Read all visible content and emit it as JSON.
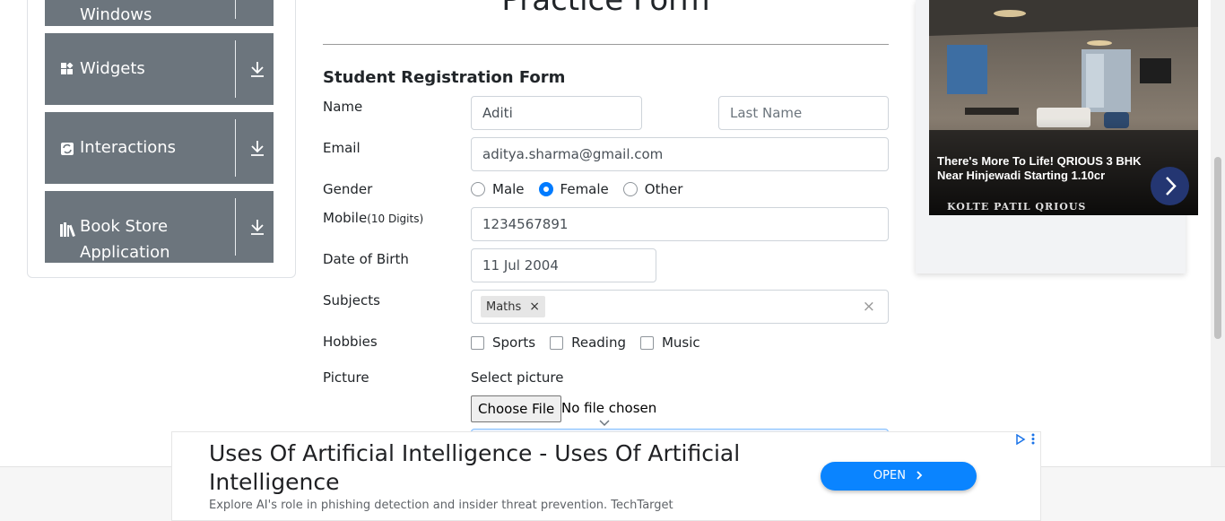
{
  "sidebar": {
    "groups": [
      {
        "label": "Windows",
        "icon": "window-icon"
      },
      {
        "label": "Widgets",
        "icon": "widgets-icon"
      },
      {
        "label": "Interactions",
        "icon": "interactions-icon"
      },
      {
        "label": "Book Store Application",
        "label_line1": "Book Store",
        "label_line2": "Application",
        "icon": "books-icon"
      }
    ]
  },
  "page": {
    "title": "Practice Form",
    "form_heading": "Student Registration Form"
  },
  "form": {
    "name_label": "Name",
    "first_name_value": "Aditi",
    "last_name_placeholder": "Last Name",
    "email_label": "Email",
    "email_value": "aditya.sharma@gmail.com",
    "gender_label": "Gender",
    "gender_options": [
      "Male",
      "Female",
      "Other"
    ],
    "gender_selected": "Female",
    "mobile_label": "Mobile",
    "mobile_hint": "(10 Digits)",
    "mobile_value": "1234567891",
    "dob_label": "Date of Birth",
    "dob_value": "11 Jul 2004",
    "subjects_label": "Subjects",
    "subjects": [
      "Maths"
    ],
    "subject_remove_glyph": "×",
    "subjects_clear_glyph": "×",
    "hobbies_label": "Hobbies",
    "hobbies": [
      "Sports",
      "Reading",
      "Music"
    ],
    "picture_label": "Picture",
    "picture_prompt": "Select picture",
    "choose_file_label": "Choose File",
    "file_status": "No file chosen"
  },
  "ad_right": {
    "headline": "There's More To Life! QRIOUS 3 BHK Near Hinjewadi Starting 1.10cr",
    "brand": "KOLTE PATIL QRIOUS",
    "button_icon": "chevron-right-icon",
    "button_color": "#243672"
  },
  "ad_bottom": {
    "title": "Uses Of Artificial Intelligence - Uses Of Artificial Intelligence",
    "description": "Explore AI's role in phishing detection and insider threat prevention. TechTarget",
    "open_label": "OPEN",
    "open_color": "#0a84ff"
  },
  "colors": {
    "sidebar_group": "#6c757d",
    "accent": "#007bff"
  }
}
